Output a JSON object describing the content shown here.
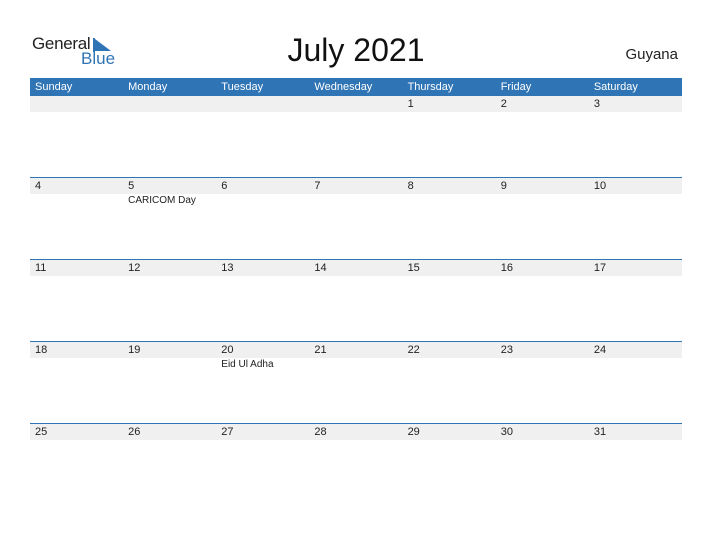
{
  "logo": {
    "word1": "General",
    "word2": "Blue"
  },
  "title": "July 2021",
  "country": "Guyana",
  "accent_color": "#2f74b5",
  "weekdays": [
    "Sunday",
    "Monday",
    "Tuesday",
    "Wednesday",
    "Thursday",
    "Friday",
    "Saturday"
  ],
  "weeks": [
    {
      "days": [
        "",
        "",
        "",
        "",
        "1",
        "2",
        "3"
      ],
      "events": [
        "",
        "",
        "",
        "",
        "",
        "",
        ""
      ]
    },
    {
      "days": [
        "4",
        "5",
        "6",
        "7",
        "8",
        "9",
        "10"
      ],
      "events": [
        "",
        "CARICOM Day",
        "",
        "",
        "",
        "",
        ""
      ]
    },
    {
      "days": [
        "11",
        "12",
        "13",
        "14",
        "15",
        "16",
        "17"
      ],
      "events": [
        "",
        "",
        "",
        "",
        "",
        "",
        ""
      ]
    },
    {
      "days": [
        "18",
        "19",
        "20",
        "21",
        "22",
        "23",
        "24"
      ],
      "events": [
        "",
        "",
        "Eid Ul Adha",
        "",
        "",
        "",
        ""
      ]
    },
    {
      "days": [
        "25",
        "26",
        "27",
        "28",
        "29",
        "30",
        "31"
      ],
      "events": [
        "",
        "",
        "",
        "",
        "",
        "",
        ""
      ]
    }
  ]
}
